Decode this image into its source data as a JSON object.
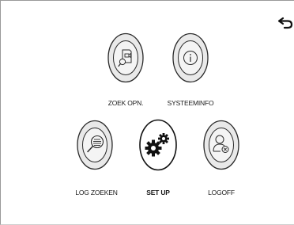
{
  "menu": {
    "items": [
      {
        "id": "zoek-opn",
        "label": "ZOEK OPN.",
        "icon": "search-recording-icon",
        "active": false
      },
      {
        "id": "systeeminfo",
        "label": "SYSTEEMINFO",
        "icon": "info-icon",
        "active": false
      },
      {
        "id": "log-zoeken",
        "label": "LOG ZOEKEN",
        "icon": "log-search-icon",
        "active": false
      },
      {
        "id": "set-up",
        "label": "SET UP",
        "icon": "gears-icon",
        "active": true
      },
      {
        "id": "logoff",
        "label": "LOGOFF",
        "icon": "user-logoff-icon",
        "active": false
      }
    ]
  },
  "back": {
    "icon": "back-arrow-icon"
  },
  "colors": {
    "button_fill": "#e9e9e9",
    "button_outline": "#2a2a2a",
    "active_fill": "#ffffff",
    "text": "#1a1a1a"
  }
}
